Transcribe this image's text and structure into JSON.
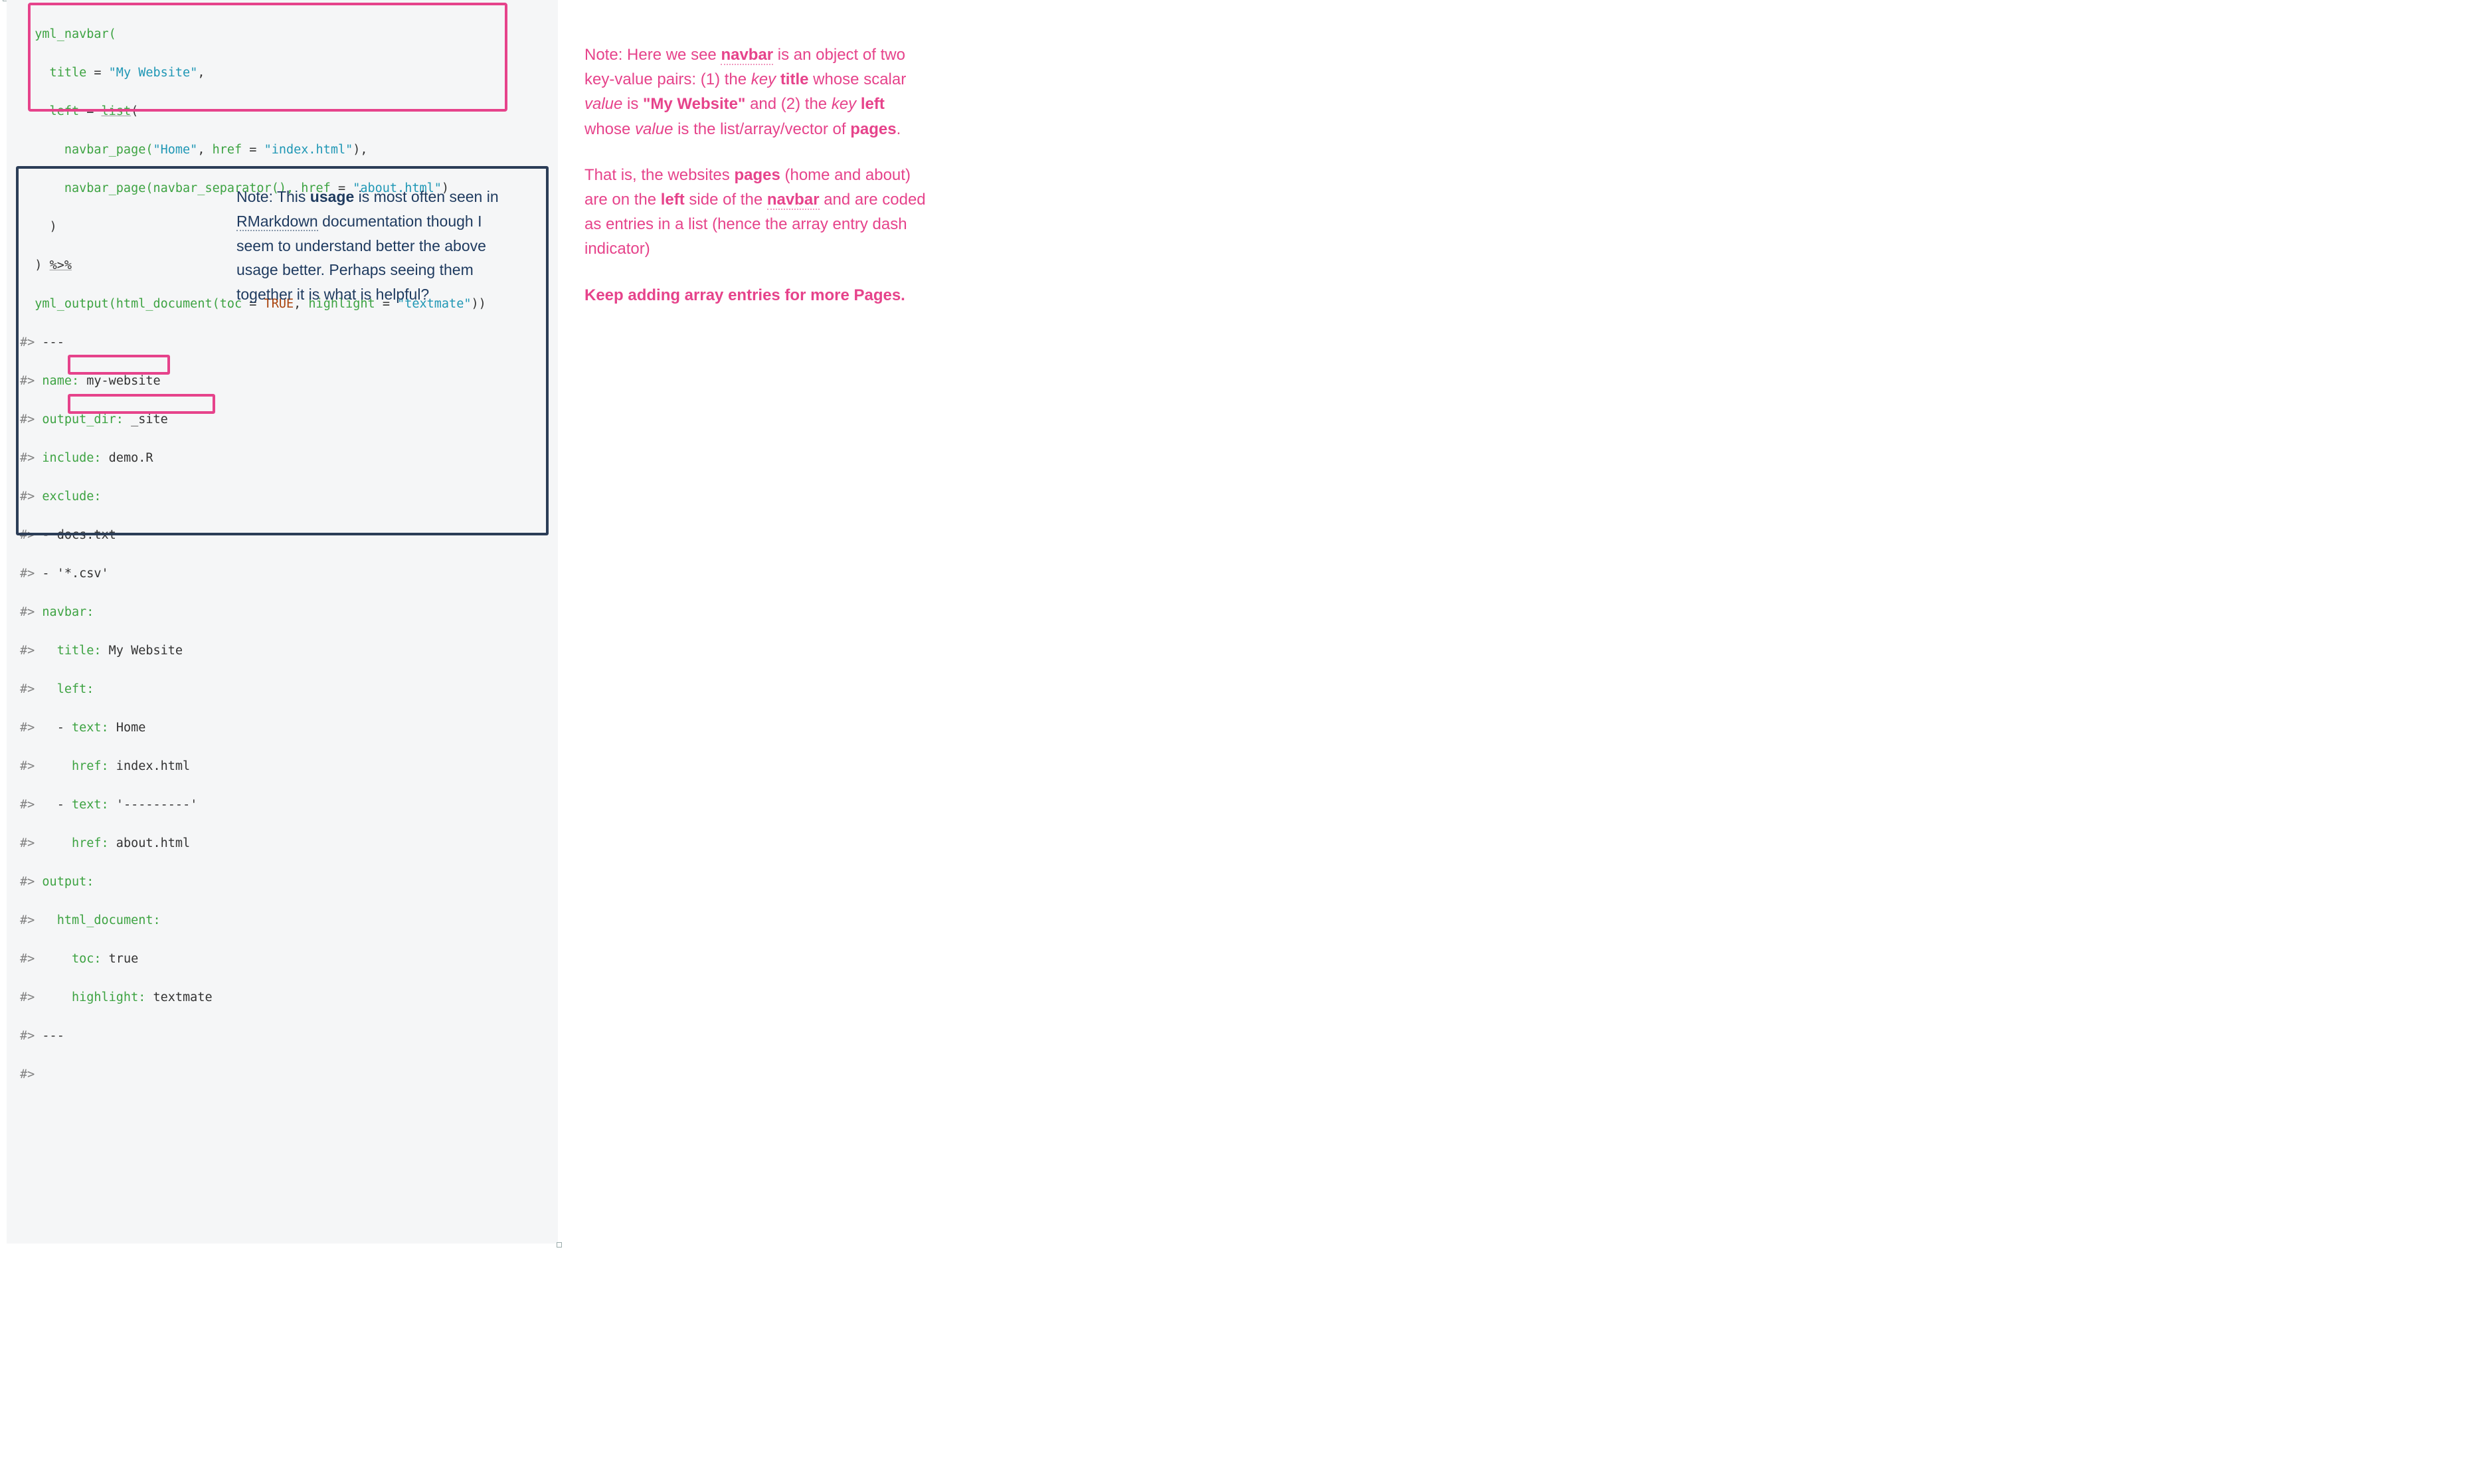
{
  "code": {
    "l1": "  yml_navbar(",
    "l2a": "    title ",
    "l2b": "= ",
    "l2c": "\"My Website\"",
    "l2d": ",",
    "l3a": "    left ",
    "l3b": "= ",
    "l3c": "list",
    "l3d": "(",
    "l4a": "      navbar_page(",
    "l4b": "\"Home\"",
    "l4c": ", ",
    "l4d": "href ",
    "l4e": "= ",
    "l4f": "\"index.html\"",
    "l4g": "),",
    "l5a": "      navbar_page(",
    "l5b": "navbar_separator(), ",
    "l5c": "href ",
    "l5d": "= ",
    "l5e": "\"about.html\"",
    "l5f": ")",
    "l6": "    )",
    "l7a": "  ) ",
    "l7b": "%>%",
    "l8a": "  yml_output(",
    "l8b": "html_document(",
    "l8c": "toc ",
    "l8d": "= ",
    "l8e": "TRUE",
    "l8f": ", ",
    "l8g": "highlight ",
    "l8h": "= ",
    "l8i": "\"textmate\"",
    "l8j": "))",
    "o1a": "#> ",
    "o1b": "---",
    "o2a": "#> ",
    "o2b": "name:",
    "o2c": " my-website",
    "o3a": "#> ",
    "o3b": "output_dir:",
    "o3c": " _site",
    "o4a": "#> ",
    "o4b": "include:",
    "o4c": " demo.R",
    "o5a": "#> ",
    "o5b": "exclude:",
    "o6a": "#> ",
    "o6b": "- docs.txt",
    "o7a": "#> ",
    "o7b": "- '*.csv'",
    "o8a": "#> ",
    "o8b": "navbar:",
    "o9a": "#>   ",
    "o9b": "title:",
    "o9c": " My Website",
    "o10a": "#>   ",
    "o10b": "left:",
    "o11a": "#>   ",
    "o11b": "- ",
    "o11c": "text:",
    "o11d": " Home",
    "o12a": "#>     ",
    "o12b": "href:",
    "o12c": " index.html",
    "o13a": "#>   ",
    "o13b": "- ",
    "o13c": "text:",
    "o13d": " '---------'",
    "o14a": "#>     ",
    "o14b": "href:",
    "o14c": " about.html",
    "o15a": "#> ",
    "o15b": "output:",
    "o16a": "#>   ",
    "o16b": "html_document:",
    "o17a": "#>     ",
    "o17b": "toc:",
    "o17c": " true",
    "o18a": "#>     ",
    "o18b": "highlight:",
    "o18c": " textmate",
    "o19a": "#> ",
    "o19b": "---",
    "o20a": "#>"
  },
  "annot": {
    "t1a": "Note: This ",
    "t1b": "usage",
    "t1c": " is most often seen in ",
    "t1d": "RMarkdown",
    "t1e": " documentation though I seem to understand better the above usage better. Perhaps seeing them together it is what is helpful?"
  },
  "notes": {
    "p1": {
      "a": "Note: Here we see ",
      "b": "navbar",
      "c": " is an object of two key-value pairs: (1) the ",
      "d": "key",
      "e": " ",
      "f": "title",
      "g": " whose scalar ",
      "h": "value",
      "i": " is ",
      "j": "\"My Website\"",
      "k": " and (2) the ",
      "l": "key",
      "m": " ",
      "n": "left",
      "o": " whose ",
      "p": "value",
      "q": " is the list/array/vector of ",
      "r": "pages",
      "s": "."
    },
    "p2": {
      "a": "That is, the websites ",
      "b": "pages",
      "c": " (home and about) are on the ",
      "d": "left",
      "e": " side of the ",
      "f": "navbar",
      "g": " and are coded as entries in a list (hence the array entry dash indicator)"
    },
    "p3": "Keep adding array entries for more Pages."
  }
}
